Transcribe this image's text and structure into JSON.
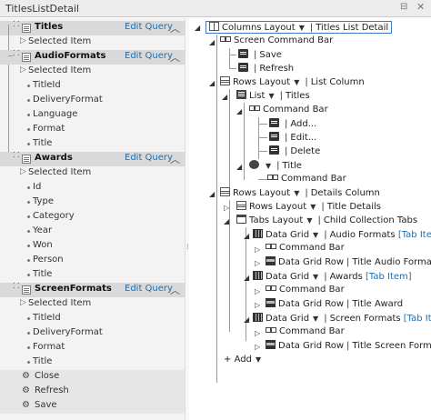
{
  "window": {
    "title": "TitlesListDetail",
    "pin_glyph": "⊟",
    "close_glyph": "✕"
  },
  "left_panel": {
    "edit_query_label": "Edit Query",
    "groups": [
      {
        "name": "Titles",
        "items": [
          "Selected Item"
        ]
      },
      {
        "name": "AudioFormats",
        "items": [
          "Selected Item",
          "TitleId",
          "DeliveryFormat",
          "Language",
          "Format",
          "Title"
        ]
      },
      {
        "name": "Awards",
        "items": [
          "Selected Item",
          "Id",
          "Type",
          "Category",
          "Year",
          "Won",
          "Person",
          "Title"
        ]
      },
      {
        "name": "ScreenFormats",
        "items": [
          "Selected Item",
          "TitleId",
          "DeliveryFormat",
          "Format",
          "Title"
        ]
      }
    ],
    "commands": [
      "Close",
      "Refresh",
      "Save"
    ]
  },
  "tree": {
    "root": {
      "control": "Columns Layout",
      "name": "Titles List Detail"
    },
    "screen_command_bar": "Screen Command Bar",
    "save": "Save",
    "refresh": "Refresh",
    "rows_layout_1": {
      "control": "Rows Layout",
      "name": "List Column"
    },
    "list": {
      "control": "List",
      "name": "Titles"
    },
    "command_bar": "Command Bar",
    "add": "Add...",
    "edit": "Edit...",
    "delete": "Delete",
    "title": "Title",
    "rows_layout_2": {
      "control": "Rows Layout",
      "name": "Details Column"
    },
    "rows_layout_3": {
      "control": "Rows Layout",
      "name": "Title Details"
    },
    "tabs_layout": {
      "control": "Tabs Layout",
      "name": "Child Collection Tabs"
    },
    "data_grid_label": "Data Grid",
    "data_grid_row_label": "Data Grid Row",
    "tab_item": "[Tab Item]",
    "grids": [
      {
        "name": "Audio Formats",
        "row": "Title Audio Format"
      },
      {
        "name": "Awards",
        "row": "Title Award"
      },
      {
        "name": "Screen Formats",
        "row": "Title Screen Format"
      }
    ],
    "add_label": "Add"
  }
}
